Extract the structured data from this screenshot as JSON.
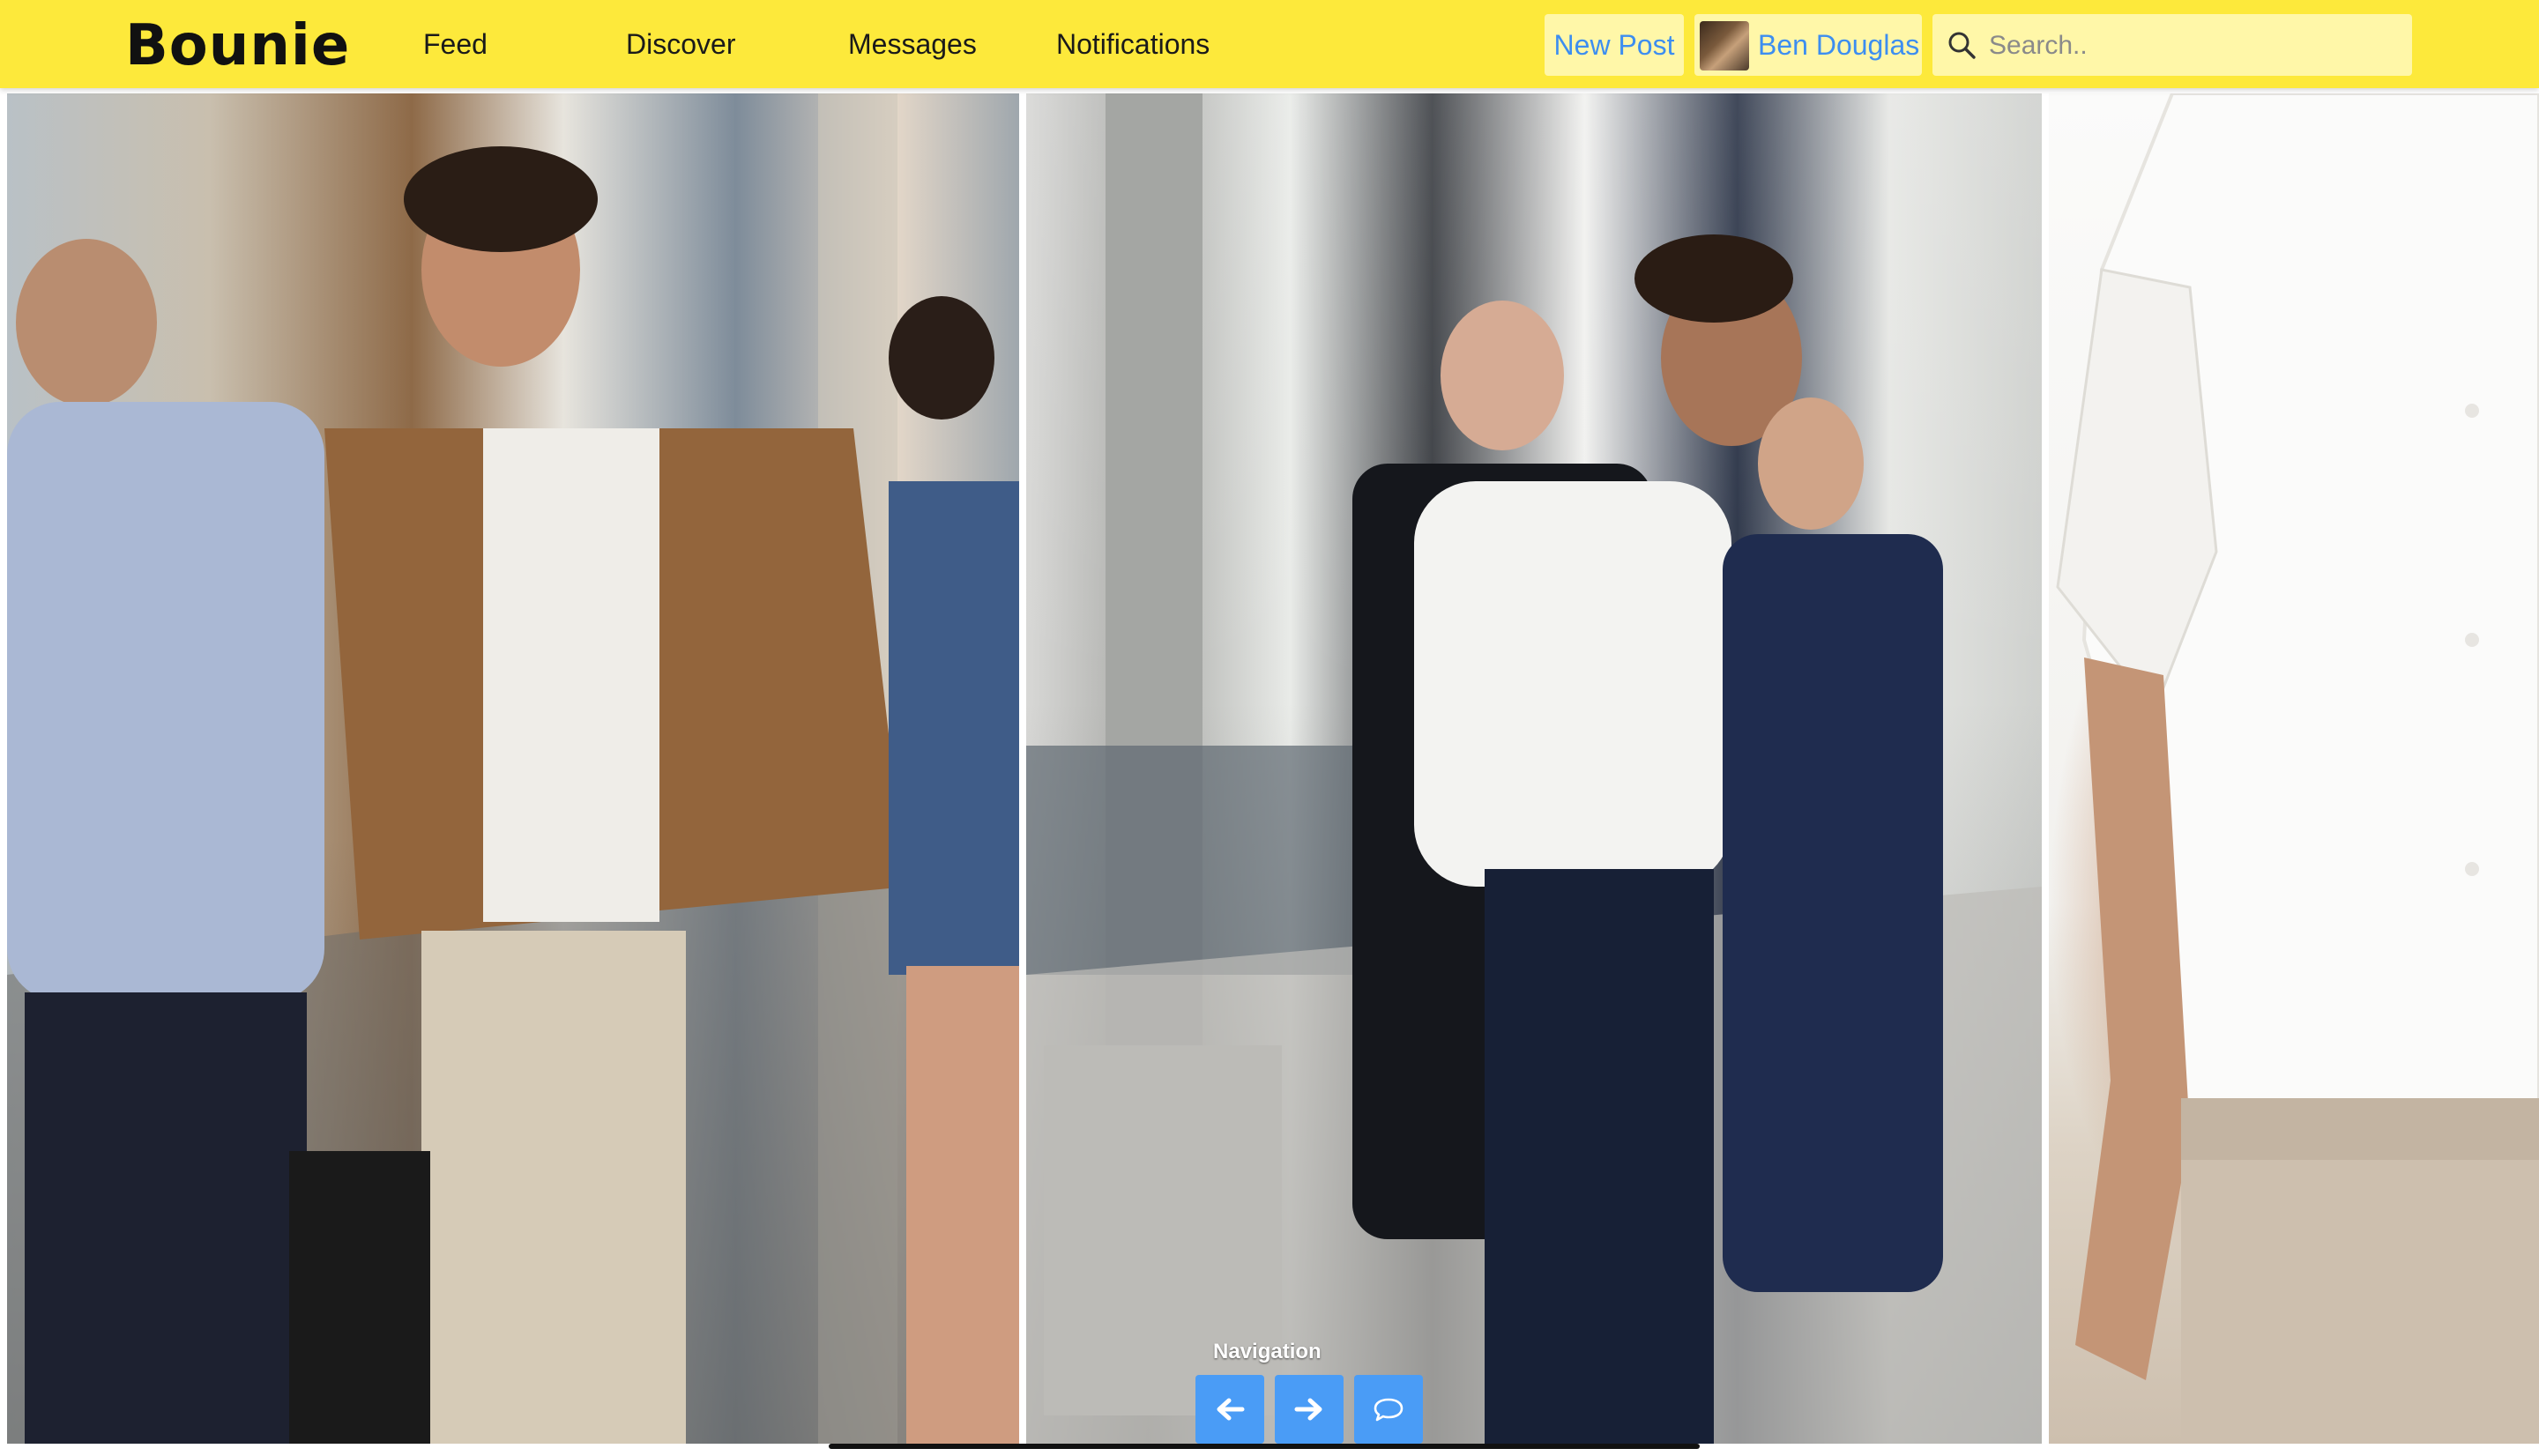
{
  "header": {
    "brand": "Bounie",
    "nav": {
      "feed": "Feed",
      "discover": "Discover",
      "messages": "Messages",
      "notifications": "Notifications"
    },
    "new_post_label": "New Post",
    "profile": {
      "name": "Ben Douglas",
      "avatar_icon": "user-avatar-photo"
    },
    "search": {
      "placeholder": "Search..",
      "value": "",
      "icon": "search-icon"
    },
    "colors": {
      "bar": "#fde93b",
      "button_bg": "#fff7a8",
      "link": "#3d8ef0"
    }
  },
  "gallery": {
    "photos": [
      {
        "subject": "street-style-photo-brown-blazer"
      },
      {
        "subject": "street-style-photo-white-shirt-pinstripe-trousers"
      },
      {
        "subject": "product-photo-white-linen-shirt"
      }
    ]
  },
  "navigation": {
    "label": "Navigation",
    "buttons": {
      "prev_icon": "arrow-left-icon",
      "next_icon": "arrow-right-icon",
      "comment_icon": "comment-bubble-icon"
    },
    "color": "#4a9cf6"
  }
}
